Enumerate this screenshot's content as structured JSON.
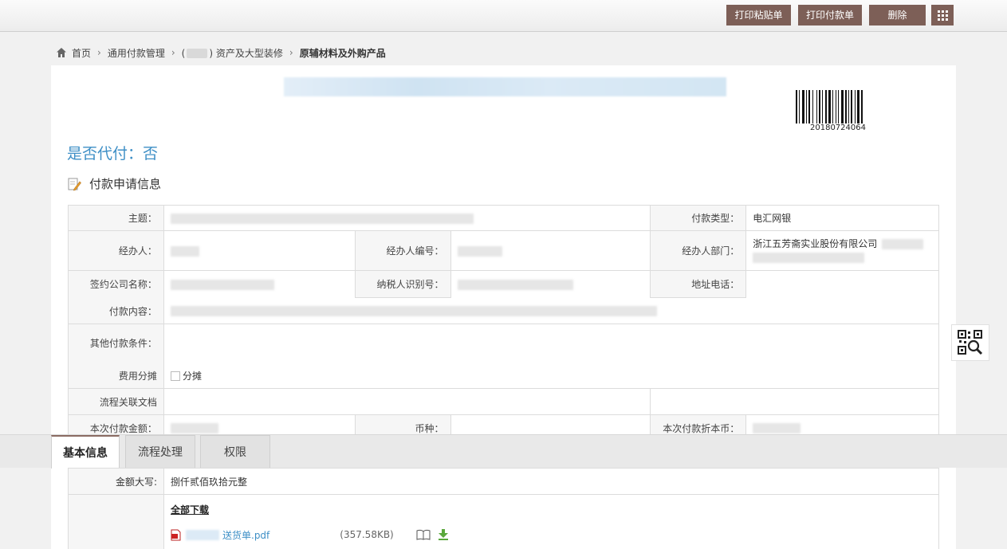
{
  "toolbar": {
    "print_sticker": "打印粘贴单",
    "print_payment": "打印付款单",
    "delete": "删除"
  },
  "breadcrumb": {
    "home": "首页",
    "level1": "通用付款管理",
    "level2": "资产及大型装修",
    "current": "原辅材料及外购产品",
    "level2_prefix": "(",
    "level2_suffix": ")"
  },
  "barcode_number": "20180724064",
  "on_behalf": "是否代付：否",
  "section_title": "付款申请信息",
  "form": {
    "subject_label": "主题：",
    "payment_type_label": "付款类型：",
    "payment_type_value": "电汇网银",
    "handler_label": "经办人：",
    "handler_no_label": "经办人编号：",
    "handler_dept_label": "经办人部门：",
    "handler_dept_value": "浙江五芳斋实业股份有限公司",
    "company_label": "签约公司名称：",
    "taxpayer_label": "纳税人识别号：",
    "address_label": "地址电话：",
    "content_label": "付款内容：",
    "other_terms_label": "其他付款条件：",
    "cost_split_label": "费用分摊",
    "cost_split_option": "分摊",
    "related_docs_label": "流程关联文档",
    "amount_label": "本次付款金额：",
    "currency_label": "币种：",
    "amount_local_label": "本次付款折本币："
  },
  "tabs": [
    "基本信息",
    "流程处理",
    "权限"
  ],
  "lower": {
    "amount_words_label": "金额大写:",
    "amount_words_value": "捌仟贰佰玖拾元整",
    "download_all": "全部下载",
    "attachment_name": "送货单.pdf",
    "attachment_size": "(357.58KB)"
  },
  "colors": {
    "toolbar_button": "#7d5f57",
    "accent_blue": "#3e8fc6"
  }
}
